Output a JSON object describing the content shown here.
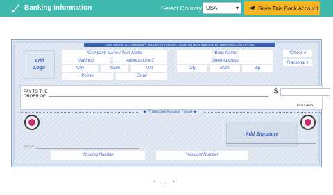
{
  "header": {
    "title": "Banking Information",
    "select_label": "Select Country",
    "country_value": "USA",
    "save_button": "Save This Bank Account"
  },
  "check": {
    "security_text": "CASH ONLY IF ALL CheckLock™ SECURITY FEATURES LISTED ON BACK INDICATE NO TAMPERING OR COPYING",
    "logo_line1": "Add",
    "logo_line2": "Logo",
    "company_name": "*Company Name / Your Name",
    "address": "*Address",
    "address_line2": "Address Line 2",
    "city": "*City",
    "state": "*State",
    "zip": "*Zip",
    "phone": "Phone",
    "email": "Email",
    "bank_name": "*Bank Name",
    "bank_address": "Street Address",
    "bank_city": "City",
    "bank_state": "State",
    "bank_zip": "Zip",
    "check_number": "*Check #",
    "fractional": "Fractional #",
    "pay_to_line1": "PAY TO THE",
    "pay_to_line2": "ORDER OF",
    "dollar_sign": "$",
    "dollars": "DOLLARS",
    "protected": "Protected Against Fraud",
    "add_signature": "Add Signature",
    "memo": "MEMO",
    "routing": "*Routing Number",
    "account": "*Account Number"
  },
  "footer": {
    "dots": "⠈ ⠒⠒ ⠈"
  },
  "colors": {
    "topbar": "#3fb9ad",
    "save_button": "#f6b421",
    "field_text": "#3d66c4"
  }
}
